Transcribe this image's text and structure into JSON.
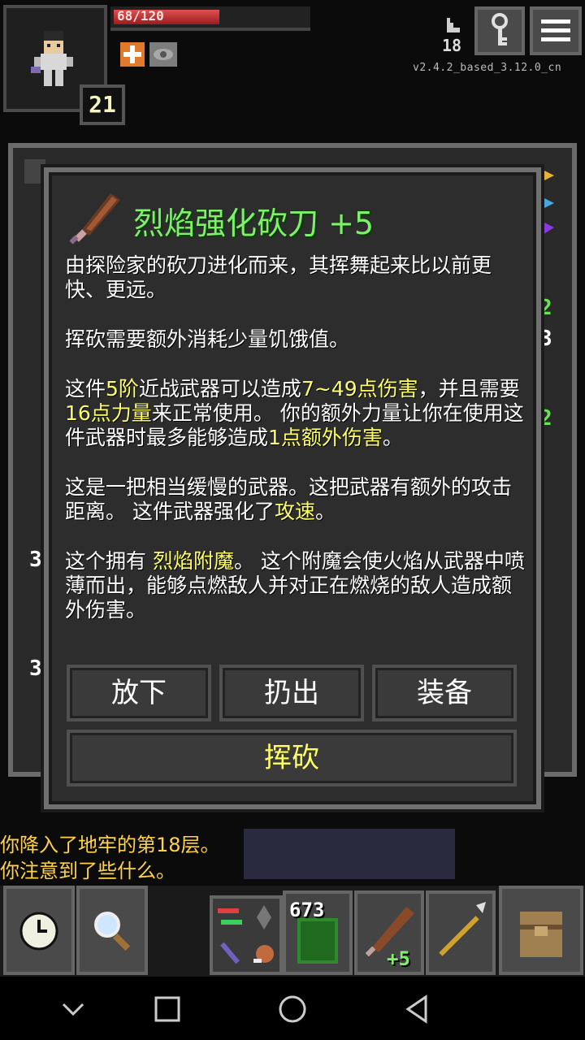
{
  "status": {
    "hp_text": "68/120",
    "hp_fraction": 0.567,
    "level": "21",
    "depth": "18",
    "version": "v2.4.2_based_3.12.0_cn"
  },
  "dialog": {
    "title": "烈焰强化砍刀 +5",
    "desc_1": "由探险家的砍刀进化而来，其挥舞起来比以前更快、更远。",
    "desc_2": "挥砍需要额外消耗少量饥饿值。",
    "desc_3": {
      "a": "这件",
      "tier": "5阶",
      "b": "近战武器可以造成",
      "damage": "7~49点伤害",
      "c": "，并且需要",
      "strength": "16点力量",
      "d": "来正常使用。 你的额外力量让你在使用这件武器时最多能够造成",
      "bonus": "1点额外伤害",
      "e": "。"
    },
    "desc_4": {
      "a": "这是一把相当缓慢的武器。这把武器有额外的攻击距离。 这件武器强化了",
      "speed": "攻速",
      "b": "。"
    },
    "desc_5": {
      "a": "这个拥有 ",
      "enchant": "烈焰附魔",
      "b": "。 这个附魔会使火焰从武器中喷薄而出，能够点燃敌人并对正在燃烧的敌人造成额外伤害。"
    },
    "buttons": {
      "drop": "放下",
      "throw": "扔出",
      "equip": "装备",
      "chop": "挥砍"
    }
  },
  "background": {
    "nums": [
      "2",
      "3",
      "2",
      "3",
      "3"
    ]
  },
  "log": {
    "line1": "你降入了地牢的第18层。",
    "line2": "你注意到了些什么。"
  },
  "toolbar": {
    "gold": "673",
    "weapon_level": "+5"
  },
  "colors": {
    "title_green": "#7ef06a",
    "highlight_yellow": "#ffff66",
    "log_orange": "#ffd24a",
    "hp_red": "#c03030"
  }
}
